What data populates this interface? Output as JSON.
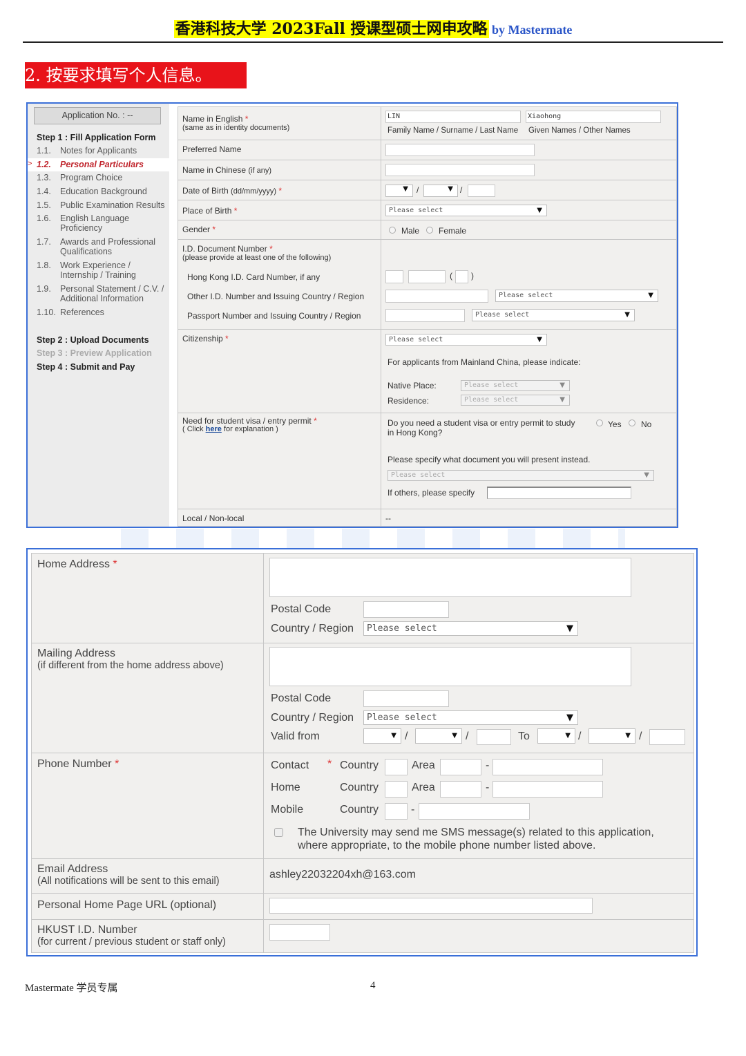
{
  "header": {
    "title": "香港科技大学 2023Fall 授课型硕士网申攻略",
    "byline": "by Mastermate",
    "highlight_color": "#ffff00",
    "byline_color": "#2a55c8"
  },
  "section_banner": {
    "text": "2. 按要求填写个人信息。",
    "color": "#e8131a"
  },
  "sidebar": {
    "app_no": "Application No. : --",
    "step1": "Step 1 : Fill Application Form",
    "items": [
      {
        "num": "1.1.",
        "label": "Notes for Applicants"
      },
      {
        "num": "1.2.",
        "label": "Personal Particulars",
        "active": true
      },
      {
        "num": "1.3.",
        "label": "Program Choice"
      },
      {
        "num": "1.4.",
        "label": "Education Background"
      },
      {
        "num": "1.5.",
        "label": "Public Examination Results"
      },
      {
        "num": "1.6.",
        "label": "English Language",
        "label2": "Proficiency"
      },
      {
        "num": "1.7.",
        "label": "Awards and Professional",
        "label2": "Qualifications"
      },
      {
        "num": "1.8.",
        "label": "Work Experience /",
        "label2": "Internship / Training"
      },
      {
        "num": "1.9.",
        "label": "Personal Statement / C.V. /",
        "label2": "Additional Information"
      },
      {
        "num": "1.10.",
        "label": "References"
      }
    ],
    "active_marker": ">",
    "step2": "Step 2 : Upload Documents",
    "step3": "Step 3 : Preview Application",
    "step4": "Step 4 : Submit and Pay"
  },
  "form1": {
    "name_en": {
      "label": "Name in English",
      "note": "(same as in identity documents)",
      "family_value": "LIN",
      "given_value": "Xiaohong",
      "family_caption": "Family Name / Surname / Last Name",
      "given_caption": "Given Names / Other Names"
    },
    "preferred_name": {
      "label": "Preferred Name"
    },
    "name_cn": {
      "label": "Name in Chinese",
      "note": "(if any)"
    },
    "dob": {
      "label": "Date of Birth",
      "note": "(dd/mm/yyyy)",
      "sep": "/"
    },
    "place_of_birth": {
      "label": "Place of Birth",
      "select": "Please select"
    },
    "gender": {
      "label": "Gender",
      "options": [
        "Male",
        "Female"
      ]
    },
    "id_doc": {
      "label": "I.D. Document Number",
      "note": "(please provide at least one of the following)",
      "hkid": "Hong Kong I.D. Card Number, if any",
      "other": "Other I.D. Number and Issuing Country / Region",
      "passport": "Passport Number and Issuing Country / Region",
      "select": "Please select",
      "paren_open": "(",
      "paren_close": ")"
    },
    "citizenship": {
      "label": "Citizenship",
      "select": "Please select",
      "mainland_note": "For applicants from Mainland China, please indicate:",
      "native_place": "Native Place:",
      "residence": "Residence:",
      "sub_select": "Please select"
    },
    "visa": {
      "label": "Need for student visa / entry permit",
      "click_pre": "( Click ",
      "click_link": "here",
      "click_post": " for explanation )",
      "question1": "Do you need a student visa or entry permit to study",
      "question2": "in Hong Kong?",
      "options": [
        "Yes",
        "No"
      ],
      "specify": "Please specify what document you will present instead.",
      "select": "Please select",
      "others": "If others, please specify"
    },
    "local": {
      "label": "Local / Non-local",
      "value": "--"
    },
    "required_mark": "*"
  },
  "form2": {
    "home_address": {
      "label": "Home Address",
      "postal": "Postal Code",
      "country": "Country / Region",
      "select": "Please select"
    },
    "mailing_address": {
      "label": "Mailing Address",
      "note": "(if different from the home address above)",
      "postal": "Postal Code",
      "country": "Country / Region",
      "select": "Please select",
      "valid_from": "Valid from",
      "to": "To",
      "sep": "/"
    },
    "phone": {
      "label": "Phone Number",
      "contact": "Contact",
      "home": "Home",
      "mobile": "Mobile",
      "country": "Country",
      "area": "Area",
      "dash": "-",
      "sms1": "The University may send me SMS message(s) related to this application,",
      "sms2": "where appropriate, to the mobile phone number listed above.",
      "sms_checked": false
    },
    "email": {
      "label": "Email Address",
      "note": "(All notifications will be sent to this email)",
      "value": "ashley22032204xh@163.com"
    },
    "homepage": {
      "label": "Personal Home Page URL (optional)"
    },
    "hkust_id": {
      "label": "HKUST I.D. Number",
      "note": "(for current / previous student or staff only)"
    },
    "required_mark": "*"
  },
  "footer": {
    "left": "Mastermate 学员专属",
    "page": "4"
  }
}
